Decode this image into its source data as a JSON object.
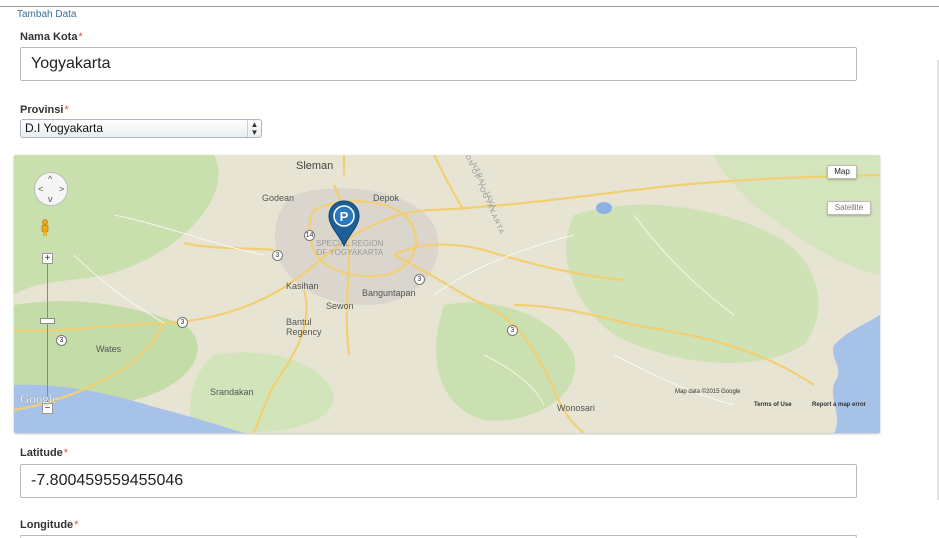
{
  "form": {
    "section_title": "Tambah Data",
    "required_mark": "*",
    "nama_kota": {
      "label": "Nama Kota",
      "value": "Yogyakarta"
    },
    "provinsi": {
      "label": "Provinsi",
      "selected": "D.I Yogyakarta"
    },
    "latitude": {
      "label": "Latitude",
      "value": "-7.800459559455046"
    },
    "longitude": {
      "label": "Longitude",
      "value": ""
    }
  },
  "map": {
    "type_buttons": {
      "map": "Map",
      "satellite": "Satellite"
    },
    "zoom": {
      "in": "+",
      "out": "−"
    },
    "pan_glyphs": {
      "up": "^",
      "down": "v",
      "left": "<",
      "right": ">"
    },
    "marker_letter": "P",
    "places": {
      "sleman": "Sleman",
      "godean": "Godean",
      "depok": "Depok",
      "special_region": "SPECIAL REGION\nOF YOGYAKARTA",
      "kasihan": "Kasihan",
      "sewon": "Sewon",
      "banguntapan": "Banguntapan",
      "bantul": "Bantul\nRegency",
      "wates": "Wates",
      "srandakan": "Srandakan",
      "wonosari": "Wonosari",
      "central_java": "NTRAL JAVA",
      "region_of_yogyakarta": "GION OF YOGYAKARTA"
    },
    "road_shields": [
      "14",
      "3",
      "3",
      "3",
      "3",
      "3"
    ],
    "google_logo": "Google",
    "attribution": {
      "map_data": "Map data ©2015 Google",
      "terms": "Terms of Use",
      "report": "Report a map error"
    },
    "colors": {
      "land": "#e8e4d3",
      "greenery": "#c4dca8",
      "urban": "#d9d6cf",
      "water": "#a7c2e8",
      "road": "#f2cf72",
      "marker": "#1e5f98"
    }
  }
}
